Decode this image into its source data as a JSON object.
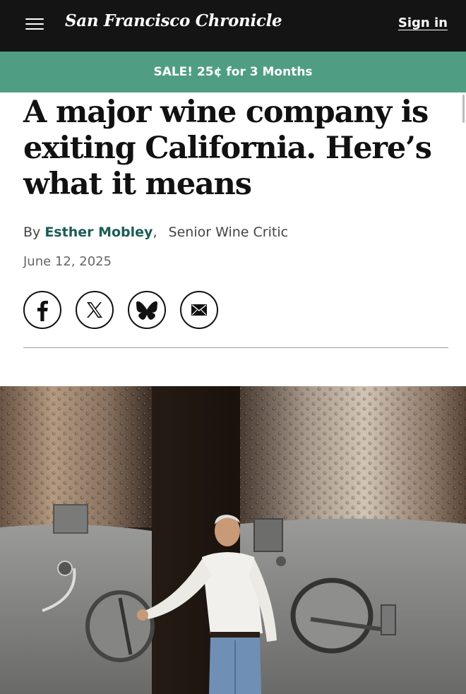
{
  "header": {
    "logo_text": "San Francisco Chronicle",
    "signin_label": "Sign in",
    "menu_icon": "hamburger-icon"
  },
  "promo": {
    "text": "SALE! 25¢ for 3 Months"
  },
  "article": {
    "headline": "A major wine company is exiting California. Here’s what it means",
    "byline_prefix": "By",
    "author": "Esther Mobley",
    "author_suffix": ",",
    "author_role": "Senior Wine Critic",
    "date": "June 12, 2025"
  },
  "share": [
    {
      "icon": "facebook-icon"
    },
    {
      "icon": "x-icon"
    },
    {
      "icon": "bluesky-icon"
    },
    {
      "icon": "email-icon"
    }
  ],
  "colors": {
    "topbar": "#141414",
    "promo": "#4f9e83",
    "author_link": "#1c5c55"
  }
}
